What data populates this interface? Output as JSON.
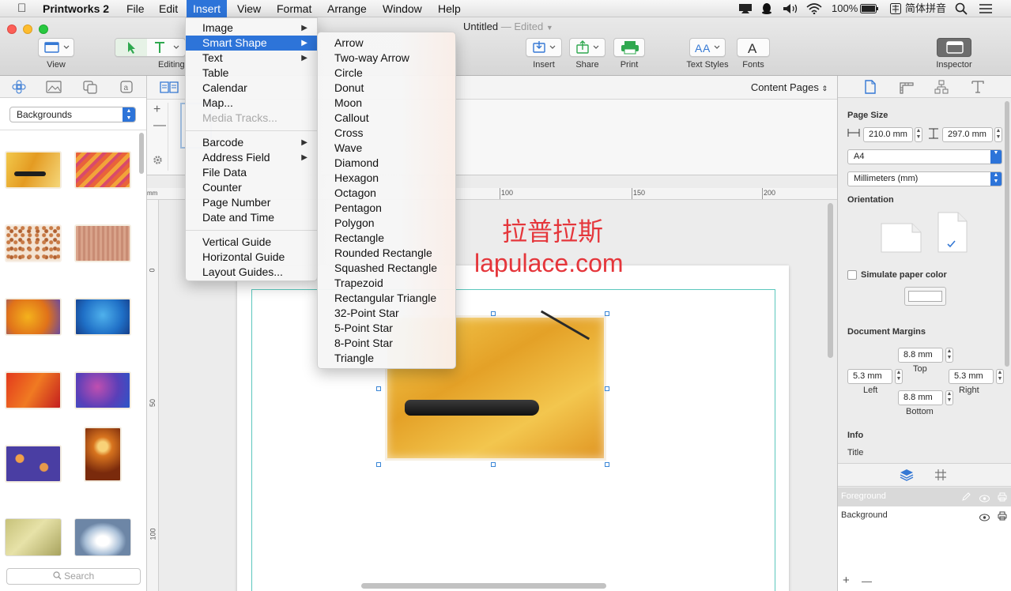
{
  "menubar": {
    "app_name": "Printworks 2",
    "items": [
      "File",
      "Edit",
      "Insert",
      "View",
      "Format",
      "Arrange",
      "Window",
      "Help"
    ],
    "active_item": "Insert",
    "status": {
      "battery": "100%",
      "input_method": "简体拼音"
    }
  },
  "window": {
    "title": "Untitled",
    "title_suffix": "— Edited"
  },
  "toolbar": {
    "view_label": "View",
    "editing_label": "Editing",
    "insert_label": "Insert",
    "share_label": "Share",
    "print_label": "Print",
    "text_styles_label": "Text Styles",
    "fonts_label": "Fonts",
    "inspector_label": "Inspector"
  },
  "leftpanel": {
    "category": "Backgrounds",
    "search_placeholder": "Search"
  },
  "content": {
    "pages_selector": "Content Pages"
  },
  "ruler": {
    "h_ticks": [
      "100",
      "150",
      "200"
    ],
    "v_ticks": [
      "0",
      "50",
      "100"
    ],
    "unit": "mm"
  },
  "watermark": {
    "line1": "拉普拉斯",
    "line2": "lapulace.com"
  },
  "insert_menu": {
    "items": [
      {
        "label": "Image",
        "submenu": true
      },
      {
        "label": "Smart Shape",
        "submenu": true,
        "active": true
      },
      {
        "label": "Text",
        "submenu": true
      },
      {
        "label": "Table"
      },
      {
        "label": "Calendar"
      },
      {
        "label": "Map..."
      },
      {
        "label": "Media Tracks...",
        "disabled": true
      },
      {
        "label": "Barcode",
        "submenu": true
      },
      {
        "label": "Address Field",
        "submenu": true
      },
      {
        "label": "File Data"
      },
      {
        "label": "Counter"
      },
      {
        "label": "Page Number"
      },
      {
        "label": "Date and Time"
      },
      {
        "label": "Vertical Guide"
      },
      {
        "label": "Horizontal Guide"
      },
      {
        "label": "Layout Guides..."
      }
    ]
  },
  "smart_shape_menu": {
    "items": [
      "Arrow",
      "Two-way Arrow",
      "Circle",
      "Donut",
      "Moon",
      "Callout",
      "Cross",
      "Wave",
      "Diamond",
      "Hexagon",
      "Octagon",
      "Pentagon",
      "Polygon",
      "Rectangle",
      "Rounded Rectangle",
      "Squashed Rectangle",
      "Trapezoid",
      "Rectangular Triangle",
      "32-Point Star",
      "5-Point Star",
      "8-Point Star",
      "Triangle"
    ]
  },
  "inspector": {
    "page_size_label": "Page Size",
    "width": "210.0 mm",
    "height": "297.0 mm",
    "paper": "A4",
    "units": "Millimeters (mm)",
    "orientation_label": "Orientation",
    "simulate_paper_label": "Simulate paper color",
    "margins_label": "Document Margins",
    "margin_top": "8.8 mm",
    "margin_top_label": "Top",
    "margin_left": "5.3 mm",
    "margin_left_label": "Left",
    "margin_right": "5.3 mm",
    "margin_right_label": "Right",
    "margin_bottom": "8.8 mm",
    "margin_bottom_label": "Bottom",
    "info_label": "Info",
    "title_label": "Title",
    "layers": [
      "Foreground",
      "Background"
    ],
    "add_symbol": "+",
    "remove_symbol": "—"
  },
  "colors": {
    "accent": "#2d74d9",
    "watermark": "#e5363b"
  }
}
